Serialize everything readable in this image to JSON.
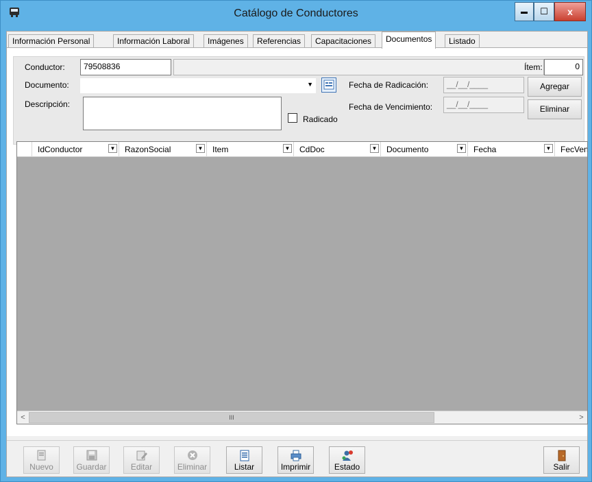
{
  "window": {
    "title": "Catálogo de Conductores",
    "minimize_label": "▬",
    "maximize_label": "☐",
    "close_label": "x"
  },
  "tabs": [
    {
      "label": "Información Personal"
    },
    {
      "label": "Información Laboral"
    },
    {
      "label": "Imágenes"
    },
    {
      "label": "Referencias"
    },
    {
      "label": "Capacitaciones"
    },
    {
      "label": "Documentos"
    },
    {
      "label": "Listado"
    }
  ],
  "active_tab": "Documentos",
  "form": {
    "conductor_label": "Conductor:",
    "conductor_value": "79508836",
    "conductor_name": "",
    "item_label": "Ítem:",
    "item_value": "0",
    "documento_label": "Documento:",
    "documento_value": "",
    "descripcion_label": "Descripción:",
    "descripcion_value": "",
    "radicado_label": "Radicado",
    "fecha_radicacion_label": "Fecha de Radicación:",
    "fecha_radicacion_value": "__/__/____",
    "fecha_vencimiento_label": "Fecha de Vencimiento:",
    "fecha_vencimiento_value": "__/__/____",
    "agregar_label": "Agregar",
    "eliminar_label": "Eliminar"
  },
  "grid": {
    "columns": [
      "IdConductor",
      "RazonSocial",
      "Item",
      "CdDoc",
      "Documento",
      "Fecha",
      "FecVence"
    ],
    "rows": [],
    "scroll_thumb": "III"
  },
  "toolbar": [
    {
      "label": "Nuevo",
      "enabled": false
    },
    {
      "label": "Guardar",
      "enabled": false
    },
    {
      "label": "Editar",
      "enabled": false
    },
    {
      "label": "Eliminar",
      "enabled": false
    },
    {
      "label": "Listar",
      "enabled": true
    },
    {
      "label": "Imprimir",
      "enabled": true
    },
    {
      "label": "Estado",
      "enabled": true
    },
    {
      "label": "Salir",
      "enabled": true
    }
  ]
}
